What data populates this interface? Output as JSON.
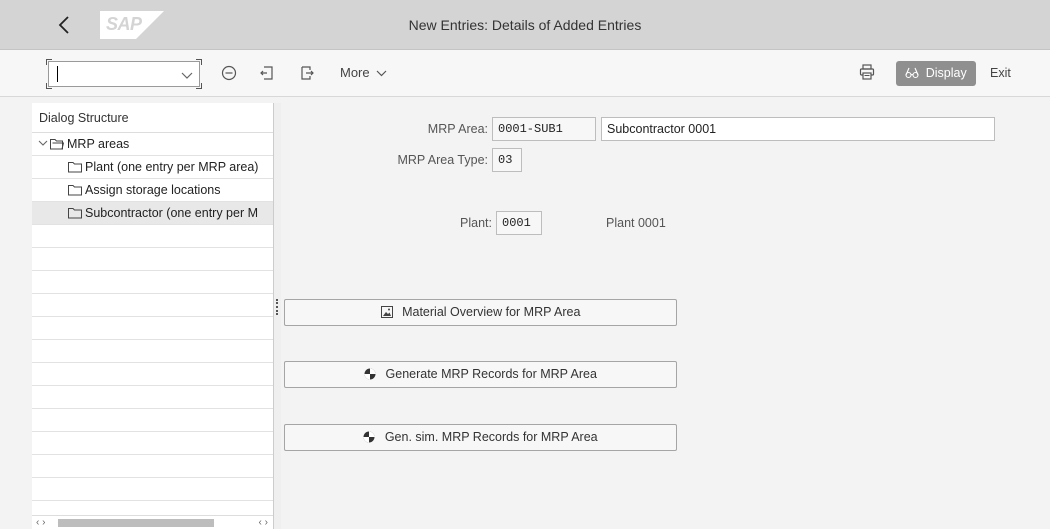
{
  "window": {
    "title": "New Entries: Details of Added Entries",
    "logo_text": "SAP"
  },
  "toolbar": {
    "command_value": "",
    "more_label": "More",
    "display_label": "Display",
    "exit_label": "Exit"
  },
  "dialog_structure": {
    "header": "Dialog Structure",
    "items": [
      {
        "label": "MRP areas",
        "level": 0,
        "expanded": true,
        "selected": false
      },
      {
        "label": "Plant (one entry per MRP area)",
        "level": 1,
        "selected": false
      },
      {
        "label": "Assign storage locations",
        "level": 1,
        "selected": false
      },
      {
        "label": "Subcontractor (one entry per M",
        "level": 1,
        "selected": true
      }
    ]
  },
  "form": {
    "mrp_area_label": "MRP Area:",
    "mrp_area_value": "0001-SUB1",
    "mrp_area_desc": "Subcontractor 0001",
    "mrp_area_type_label": "MRP Area Type:",
    "mrp_area_type_value": "03",
    "plant_label": "Plant:",
    "plant_value": "0001",
    "plant_desc": "Plant 0001"
  },
  "actions": {
    "material_overview": "Material Overview for MRP Area",
    "generate_records": "Generate MRP Records for MRP Area",
    "gen_sim_records": "Gen. sim. MRP Records for MRP Area"
  },
  "colors": {
    "titlebar_bg": "#d4d4d4",
    "display_button_bg": "#8f8f8f",
    "logo_bg": "#ffffff"
  }
}
